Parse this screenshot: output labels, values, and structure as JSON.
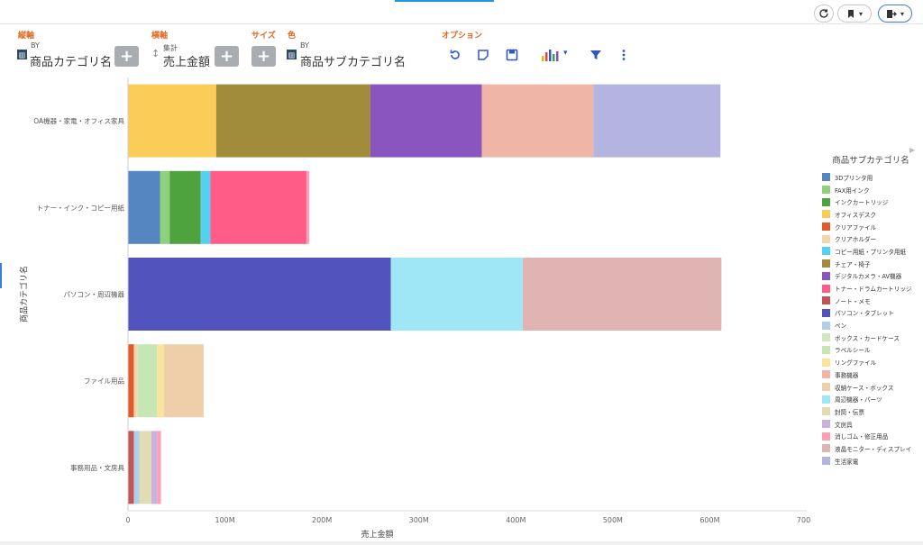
{
  "toolbar": {
    "refresh_icon": "refresh-icon",
    "bookmark_icon": "bookmark-icon",
    "export_icon": "export-icon"
  },
  "shelves": {
    "vertical": {
      "label": "縦軸",
      "by": "BY",
      "field": "商品カテゴリ名"
    },
    "horizontal": {
      "label": "横軸",
      "agg": "集計",
      "field": "売上金額"
    },
    "size": {
      "label": "サイズ"
    },
    "color": {
      "label": "色",
      "by": "BY",
      "field": "商品サブカテゴリ名"
    },
    "options": {
      "label": "オプション"
    },
    "add_label": "+"
  },
  "chart_data": {
    "type": "bar",
    "orientation": "horizontal",
    "stacked": true,
    "categories": [
      "OA機器・家電・オフィス家具",
      "トナー・インク・コピー用紙",
      "パソコン・周辺機器",
      "ファイル用品",
      "事務用品・文房具"
    ],
    "xlabel": "売上金額",
    "ylabel": "商品カテゴリ名",
    "xlim": [
      0,
      700
    ],
    "xticks": [
      "0",
      "100M",
      "200M",
      "300M",
      "400M",
      "500M",
      "600M",
      "700M"
    ],
    "grid": false,
    "legend_title": "商品サブカテゴリ名",
    "legend_position": "right",
    "series": [
      {
        "name": "3Dプリンタ用",
        "color": "#5686c1",
        "values": [
          0,
          33,
          0,
          0,
          0
        ]
      },
      {
        "name": "FAX用インク",
        "color": "#8ed07b",
        "values": [
          0,
          10,
          0,
          0,
          0
        ]
      },
      {
        "name": "インクカートリッジ",
        "color": "#4ea33e",
        "values": [
          0,
          32,
          0,
          0,
          0
        ]
      },
      {
        "name": "オフィスデスク",
        "color": "#fbcd58",
        "values": [
          91,
          0,
          0,
          0,
          0
        ]
      },
      {
        "name": "クリアファイル",
        "color": "#e25a2c",
        "values": [
          0,
          0,
          0,
          6,
          0
        ]
      },
      {
        "name": "クリアホルダー",
        "color": "#f3d5b0",
        "values": [
          0,
          0,
          0,
          4,
          0
        ]
      },
      {
        "name": "コピー用紙・プリンタ用紙",
        "color": "#54d1f2",
        "values": [
          0,
          10,
          0,
          0,
          0
        ]
      },
      {
        "name": "チェア・椅子",
        "color": "#a08c3a",
        "values": [
          159,
          0,
          0,
          0,
          0
        ]
      },
      {
        "name": "デジタルカメラ・AV機器",
        "color": "#8b55bf",
        "values": [
          115,
          0,
          0,
          0,
          0
        ]
      },
      {
        "name": "トナー・ドラムカートリッジ",
        "color": "#ff5c87",
        "values": [
          0,
          99,
          0,
          0,
          0
        ]
      },
      {
        "name": "ノート・メモ",
        "color": "#c05656",
        "values": [
          0,
          0,
          0,
          0,
          6
        ]
      },
      {
        "name": "パソコン・タブレット",
        "color": "#5353be",
        "values": [
          0,
          0,
          271,
          0,
          0
        ]
      },
      {
        "name": "ペン",
        "color": "#b3cfe8",
        "values": [
          0,
          0,
          0,
          0,
          6
        ]
      },
      {
        "name": "ボックス・カードケース",
        "color": "#cfe8be",
        "values": [
          0,
          0,
          0,
          0,
          0
        ]
      },
      {
        "name": "ラベルシール",
        "color": "#c6e7b3",
        "values": [
          0,
          0,
          0,
          20,
          0
        ]
      },
      {
        "name": "リングファイル",
        "color": "#fbe39a",
        "values": [
          0,
          0,
          0,
          7,
          0
        ]
      },
      {
        "name": "事務機器",
        "color": "#efb6a7",
        "values": [
          115,
          0,
          0,
          0,
          0
        ]
      },
      {
        "name": "収納ケース・ボックス",
        "color": "#eecfa9",
        "values": [
          0,
          0,
          0,
          41,
          0
        ]
      },
      {
        "name": "周辺機器・パーツ",
        "color": "#9fe6f7",
        "values": [
          0,
          0,
          136,
          0,
          0
        ]
      },
      {
        "name": "封筒・伝票",
        "color": "#e3dbb2",
        "values": [
          0,
          0,
          0,
          0,
          12
        ]
      },
      {
        "name": "文房具",
        "color": "#c8b3e0",
        "values": [
          0,
          0,
          0,
          0,
          6
        ]
      },
      {
        "name": "消しゴム・修正用品",
        "color": "#ff9fb4",
        "values": [
          0,
          3,
          0,
          0,
          4
        ]
      },
      {
        "name": "液晶モニター・ディスプレイ",
        "color": "#e1b4b4",
        "values": [
          0,
          0,
          205,
          0,
          0
        ]
      },
      {
        "name": "生活家電",
        "color": "#b4b4e0",
        "values": [
          131,
          0,
          0,
          0,
          0
        ]
      }
    ]
  }
}
